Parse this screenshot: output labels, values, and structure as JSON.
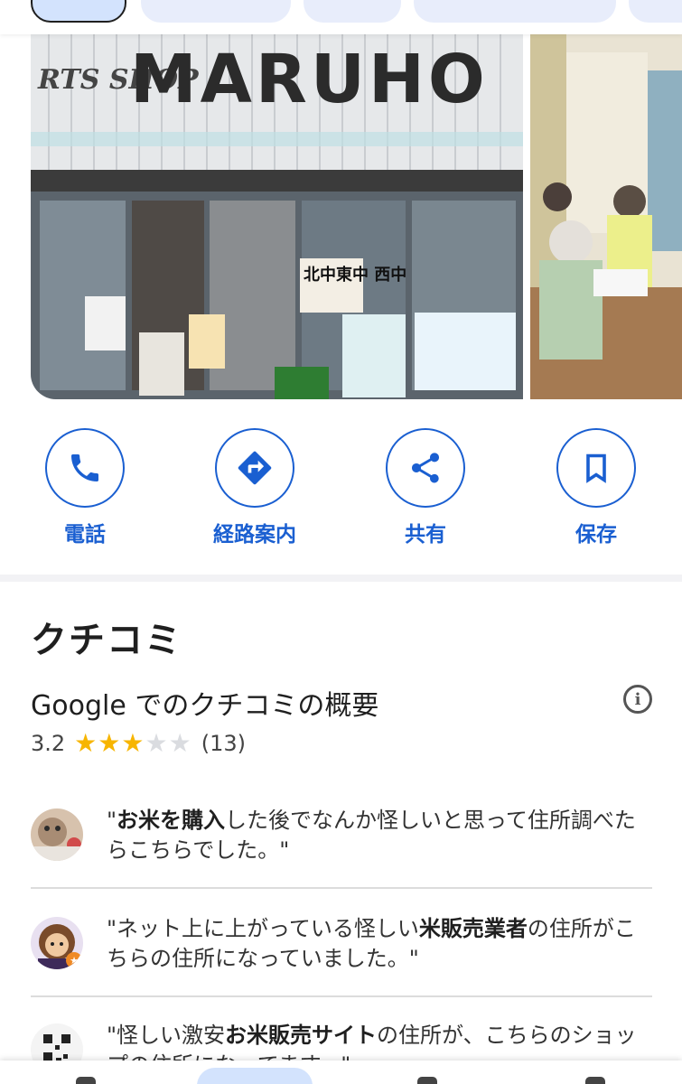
{
  "actions": [
    {
      "label": "電話",
      "icon": "phone-icon"
    },
    {
      "label": "経路案内",
      "icon": "directions-icon"
    },
    {
      "label": "共有",
      "icon": "share-icon"
    },
    {
      "label": "保存",
      "icon": "bookmark-icon"
    }
  ],
  "photos": {
    "main": {
      "sign_text": "MARUHO",
      "sub_sign": "RTS SHOP",
      "poster_text": "北中東中 西中"
    },
    "side": {
      "description": ""
    }
  },
  "reviews_section": {
    "title": "クチコミ",
    "summary_title": "Google でのクチコミの概要",
    "rating": "3.2",
    "stars_filled": 3,
    "stars_total": 5,
    "count": "(13)"
  },
  "reviews": [
    {
      "pre": "\"",
      "bold": "お米を購入",
      "post": "した後でなんか怪しいと思って住所調べたらこちらでした。\""
    },
    {
      "pre": "\"ネット上に上がっている怪しい",
      "bold": "米販売業者",
      "post": "の住所がこちらの住所になっていました。\""
    },
    {
      "pre": "\"怪しい激安",
      "bold": "お米販売サイト",
      "post": "の住所が、こちらのショップの住所になってます。\""
    }
  ],
  "colors": {
    "accent": "#1a5fd1",
    "star": "#f7b500",
    "chip": "#e8edfb"
  }
}
